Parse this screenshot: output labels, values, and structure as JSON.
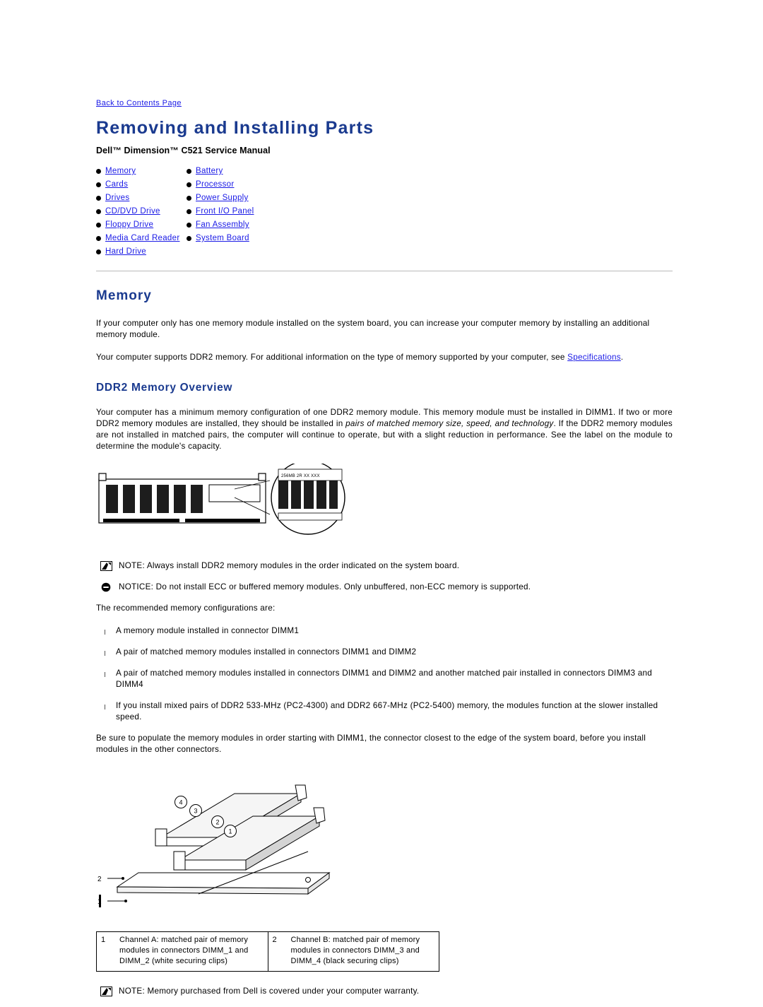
{
  "header": {
    "back_link": "Back to Contents Page",
    "title": "Removing and Installing Parts",
    "subtitle": "Dell™ Dimension™ C521 Service Manual"
  },
  "toc": {
    "left": [
      "Memory",
      "Cards",
      "Drives",
      "CD/DVD Drive",
      "Floppy Drive",
      "Media Card Reader",
      "Hard Drive"
    ],
    "right": [
      "Battery",
      "Processor",
      "Power Supply",
      "Front I/O Panel",
      "Fan Assembly",
      "System Board"
    ]
  },
  "memory": {
    "heading": "Memory",
    "para1": "If your computer only has one memory module installed on the system board, you can increase your computer memory by installing an additional memory module.",
    "para2_before": "Your computer supports DDR2 memory. For additional information on the type of memory supported by your computer, see ",
    "para2_link": "Specifications",
    "para2_after": ".",
    "overview_heading": "DDR2 Memory Overview",
    "overview_p1_a": "Your computer has a minimum memory configuration of one DDR2 memory module. This memory module must be installed in DIMM1. If two or more DDR2 memory modules are installed, they should be installed in ",
    "overview_p1_em": "pairs of matched memory size, speed, and technology",
    "overview_p1_b": ". If the DDR2 memory modules are not installed in matched pairs, the computer will continue to operate, but with a slight reduction in performance. See the label on the module to determine the module's capacity.",
    "module_label": "256MB 2R XX XXX",
    "note1": "NOTE: Always install DDR2 memory modules in the order indicated on the system board.",
    "notice1": "NOTICE: Do not install ECC or buffered memory modules. Only unbuffered, non-ECC memory is supported.",
    "recommended_intro": "The recommended memory configurations are:",
    "recommended": [
      "A memory module installed in connector DIMM1",
      "A pair of matched memory modules installed in connectors DIMM1 and DIMM2",
      "A pair of matched memory modules installed in connectors DIMM1 and DIMM2 and another matched pair installed in connectors DIMM3 and DIMM4",
      "If you install mixed pairs of DDR2 533-MHz (PC2-4300) and DDR2 667-MHz (PC2-5400) memory, the modules function at the slower installed speed."
    ],
    "populate_note": "Be sure to populate the memory modules in order starting with DIMM1, the connector closest to the edge of the system board, before you install modules in the other connectors.",
    "callouts": [
      "1",
      "2",
      "3",
      "4"
    ],
    "legend": [
      {
        "num": "1",
        "text": "Channel A: matched pair of memory modules in connectors DIMM_1 and DIMM_2 (white securing clips)"
      },
      {
        "num": "2",
        "text": "Channel B: matched pair of memory modules in connectors DIMM_3 and DIMM_4 (black securing clips)"
      }
    ],
    "note2": "NOTE: Memory purchased from Dell is covered under your computer warranty."
  },
  "colors": {
    "link": "#1a1ae6",
    "heading": "#1a3a8f",
    "rule": "#b9b9b9"
  }
}
